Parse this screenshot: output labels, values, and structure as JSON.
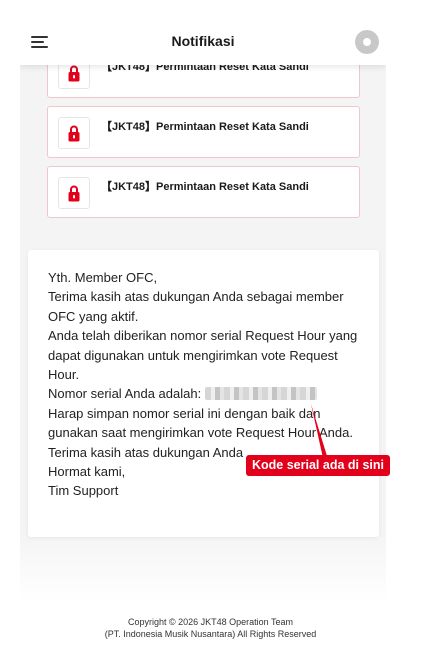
{
  "header": {
    "title": "Notifikasi",
    "menu_icon": "hamburger-menu-icon",
    "avatar_icon": "user-avatar-icon"
  },
  "notifications": [
    {
      "title": "【JKT48】Permintaan Reset Kata Sandi",
      "icon": "lock-icon"
    },
    {
      "title": "【JKT48】Permintaan Reset Kata Sandi",
      "icon": "lock-icon"
    },
    {
      "title": "【JKT48】Permintaan Reset Kata Sandi",
      "icon": "lock-icon"
    }
  ],
  "message": {
    "line1": "Yth. Member OFC,",
    "line2": "Terima kasih atas dukungan Anda sebagai member OFC yang aktif.",
    "line3": "Anda telah diberikan nomor serial Request Hour yang dapat digunakan untuk mengirimkan vote Request Hour.",
    "serial_prefix": "Nomor serial Anda adalah:",
    "line5": "Harap simpan nomor serial ini dengan baik dan gunakan saat mengirimkan vote Request Hour Anda.",
    "line6": "Terima kasih atas dukungan Anda",
    "line7": "Hormat kami,",
    "line8": "Tim Support"
  },
  "callout": {
    "label": "Kode serial ada di sini"
  },
  "footer": {
    "line1": "Copyright © 2026 JKT48 Operation Team",
    "line2": "(PT. Indonesia Musik Nusantara) All Rights Reserved"
  },
  "colors": {
    "accent": "#e3001b",
    "card_border": "#f0c6cc",
    "background": "#f4f4f5"
  }
}
